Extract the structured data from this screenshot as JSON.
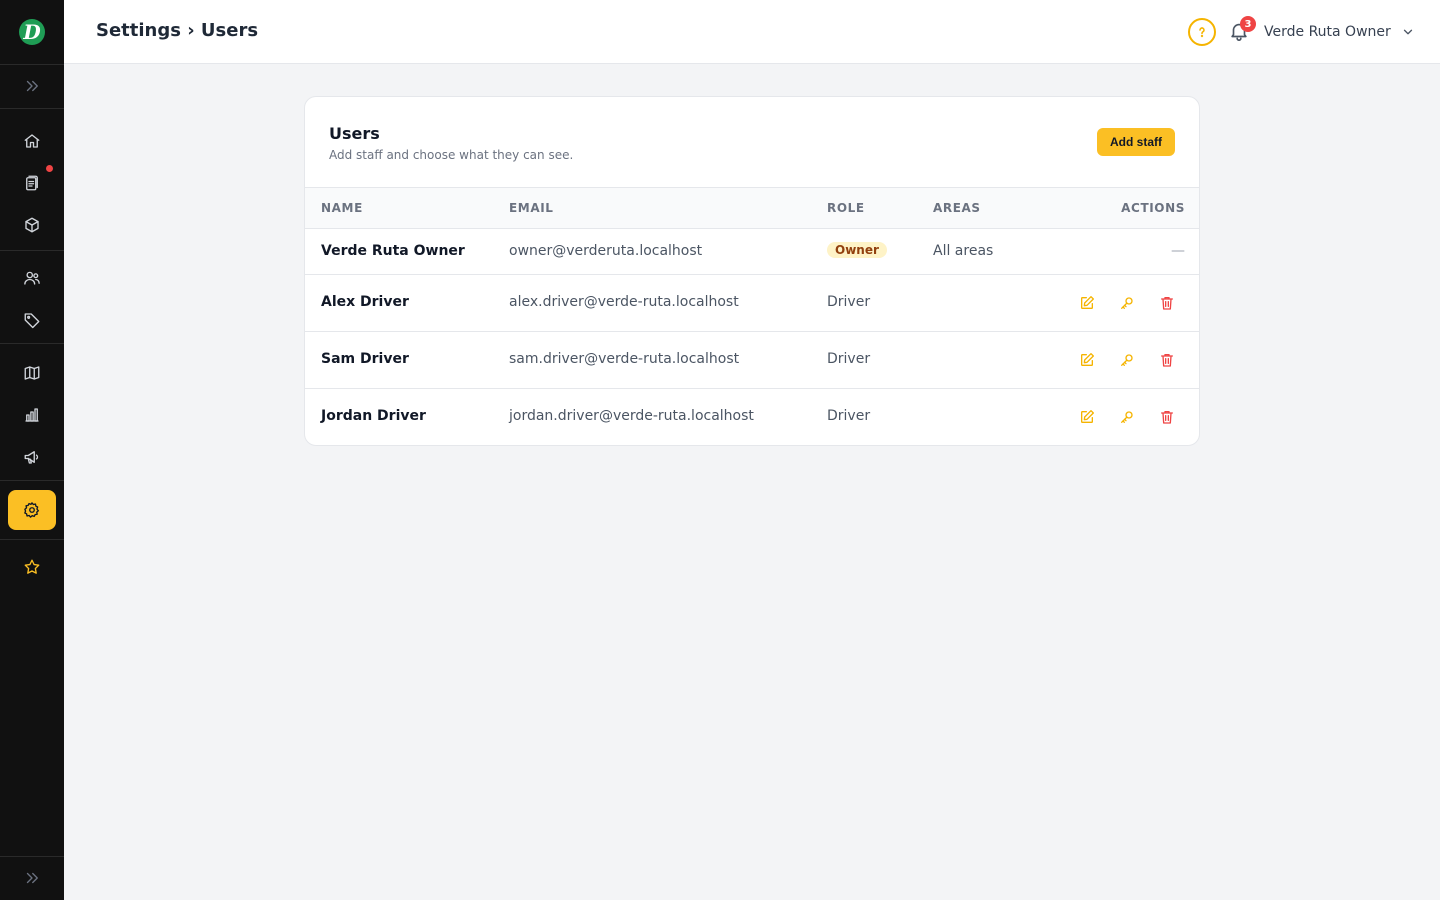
{
  "app": {
    "logo_letter": "D"
  },
  "header": {
    "title": "Settings › Users",
    "notifications_count": "3",
    "user_name": "Verde Ruta Owner"
  },
  "card": {
    "title": "Users",
    "subtitle": "Add staff and choose what they can see.",
    "add_button": "Add staff"
  },
  "table": {
    "columns": [
      "NAME",
      "EMAIL",
      "ROLE",
      "AREAS",
      "ACTIONS"
    ],
    "rows": [
      {
        "name": "Verde Ruta Owner",
        "email": "owner@verderuta.localhost",
        "role": "Owner",
        "areas": "All areas",
        "actions": "—"
      },
      {
        "name": "Alex Driver",
        "email": "alex.driver@verde-ruta.localhost",
        "role": "Driver",
        "areas": "",
        "actions": ""
      },
      {
        "name": "Sam Driver",
        "email": "sam.driver@verde-ruta.localhost",
        "role": "Driver",
        "areas": "",
        "actions": ""
      },
      {
        "name": "Jordan Driver",
        "email": "jordan.driver@verde-ruta.localhost",
        "role": "Driver",
        "areas": "",
        "actions": ""
      }
    ]
  },
  "colors": {
    "accent": "#fbbf24",
    "sidebar": "#111111",
    "danger": "#ef4444",
    "logo_green": "#1f9d55"
  },
  "icons": {
    "sidebar": [
      "expand-icon",
      "home-icon",
      "orders-icon",
      "package-icon",
      "customers-icon",
      "tag-icon",
      "map-icon",
      "chart-icon",
      "megaphone-icon",
      "settings-icon",
      "star-icon",
      "expand-icon"
    ],
    "row_actions": [
      "edit-icon",
      "key-icon",
      "trash-icon"
    ]
  }
}
